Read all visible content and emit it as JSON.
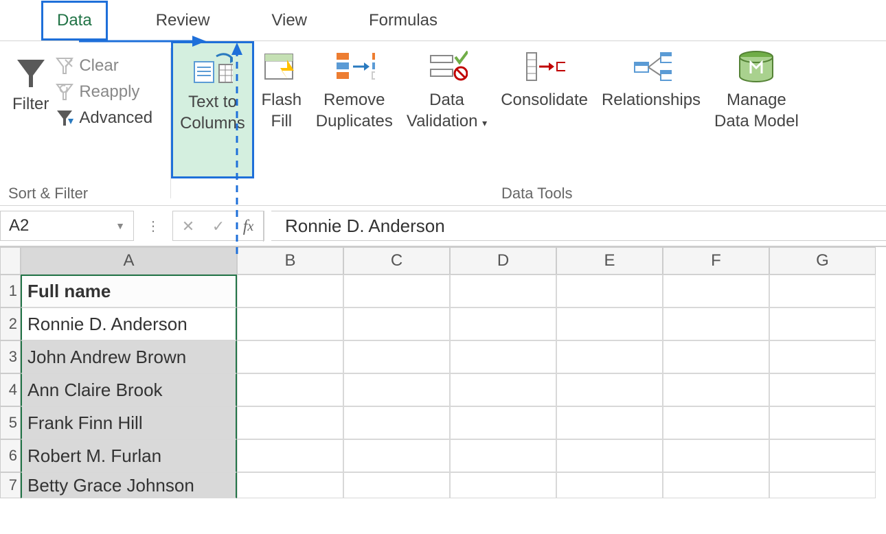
{
  "tabs": {
    "data": "Data",
    "review": "Review",
    "view": "View",
    "formulas": "Formulas"
  },
  "ribbon": {
    "filter": {
      "filter": "Filter",
      "clear": "Clear",
      "reapply": "Reapply",
      "advanced": "Advanced",
      "group_label": "Sort & Filter"
    },
    "text_to_columns": "Text to\nColumns",
    "flash_fill": "Flash\nFill",
    "remove_duplicates": "Remove\nDuplicates",
    "data_validation": "Data\nValidation",
    "consolidate": "Consolidate",
    "relationships": "Relationships",
    "manage_data_model": "Manage\nData Model",
    "data_tools_label": "Data Tools"
  },
  "formula_bar": {
    "namebox": "A2",
    "formula": "Ronnie D. Anderson"
  },
  "grid": {
    "columns": [
      "A",
      "B",
      "C",
      "D",
      "E",
      "F",
      "G"
    ],
    "rows": [
      {
        "num": 1,
        "A": "Full name",
        "header": true
      },
      {
        "num": 2,
        "A": "Ronnie D. Anderson",
        "active": true
      },
      {
        "num": 3,
        "A": "John Andrew Brown"
      },
      {
        "num": 4,
        "A": "Ann Claire Brook"
      },
      {
        "num": 5,
        "A": "Frank Finn Hill"
      },
      {
        "num": 6,
        "A": "Robert M. Furlan"
      },
      {
        "num": 7,
        "A": "Betty Grace Johnson"
      }
    ]
  }
}
